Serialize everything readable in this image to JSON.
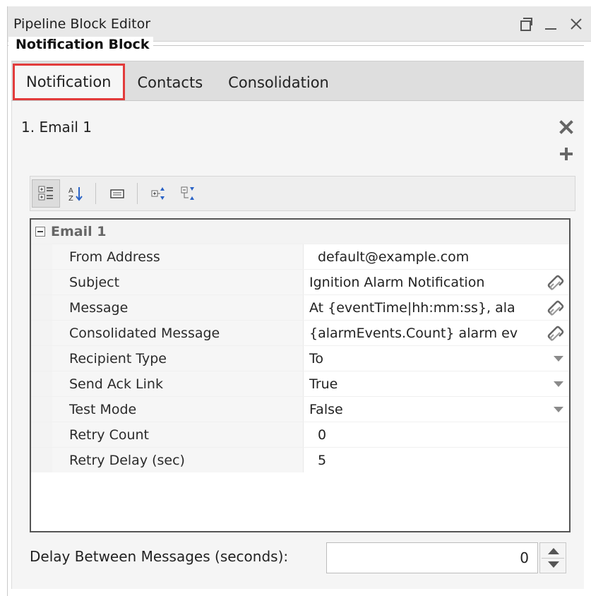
{
  "window": {
    "title": "Pipeline Block Editor",
    "controls": [
      "restore-icon",
      "minimize-icon",
      "close-icon"
    ]
  },
  "group": {
    "title": "Notification Block"
  },
  "tabs": [
    {
      "label": "Notification",
      "active": true
    },
    {
      "label": "Contacts",
      "active": false
    },
    {
      "label": "Consolidation",
      "active": false
    }
  ],
  "profile_list": {
    "item": "1.  Email 1",
    "remove_icon": "x-icon",
    "add_icon": "plus-icon"
  },
  "toolbar": {
    "buttons": [
      "categorized-icon",
      "sort-alpha-icon",
      "description-icon",
      "expand-all-icon",
      "collapse-all-icon"
    ]
  },
  "grid": {
    "category": "Email 1",
    "rows": [
      {
        "name": "From Address",
        "value": "default@example.com",
        "editor": "none"
      },
      {
        "name": "Subject",
        "value": "Ignition Alarm Notification",
        "editor": "binding"
      },
      {
        "name": "Message",
        "value": "At {eventTime|hh:mm:ss}, ala",
        "editor": "binding"
      },
      {
        "name": "Consolidated Message",
        "value": "{alarmEvents.Count} alarm ev",
        "editor": "binding"
      },
      {
        "name": "Recipient Type",
        "value": "To",
        "editor": "dropdown"
      },
      {
        "name": "Send Ack Link",
        "value": "True",
        "editor": "dropdown"
      },
      {
        "name": "Test Mode",
        "value": "False",
        "editor": "dropdown"
      },
      {
        "name": "Retry Count",
        "value": "0",
        "editor": "none"
      },
      {
        "name": "Retry Delay (sec)",
        "value": "5",
        "editor": "none"
      }
    ]
  },
  "delay": {
    "label": "Delay Between Messages (seconds):",
    "value": "0"
  },
  "colors": {
    "active_tab_outline": "#e23b3b",
    "titlebar": "#e8e8e8",
    "tabbar": "#dedede"
  }
}
